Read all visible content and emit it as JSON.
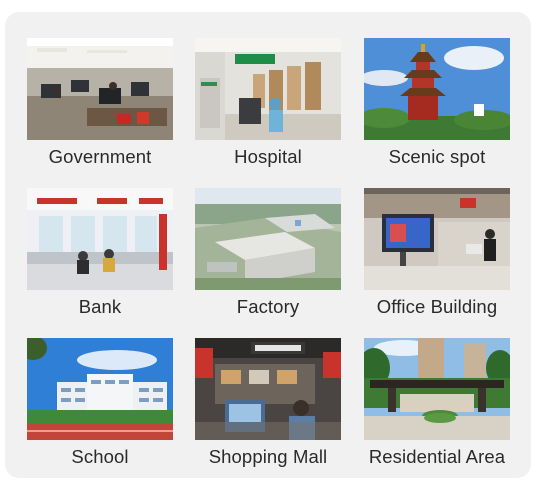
{
  "items": [
    {
      "label": "Government",
      "image": "government-office-photo"
    },
    {
      "label": "Hospital",
      "image": "hospital-corridor-photo"
    },
    {
      "label": "Scenic spot",
      "image": "scenic-pagoda-photo"
    },
    {
      "label": "Bank",
      "image": "bank-counter-photo"
    },
    {
      "label": "Factory",
      "image": "factory-aerial-photo"
    },
    {
      "label": "Office Building",
      "image": "office-lobby-photo"
    },
    {
      "label": "School",
      "image": "school-campus-photo"
    },
    {
      "label": "Shopping Mall",
      "image": "shopping-mall-photo"
    },
    {
      "label": "Residential Area",
      "image": "residential-gate-photo"
    }
  ]
}
